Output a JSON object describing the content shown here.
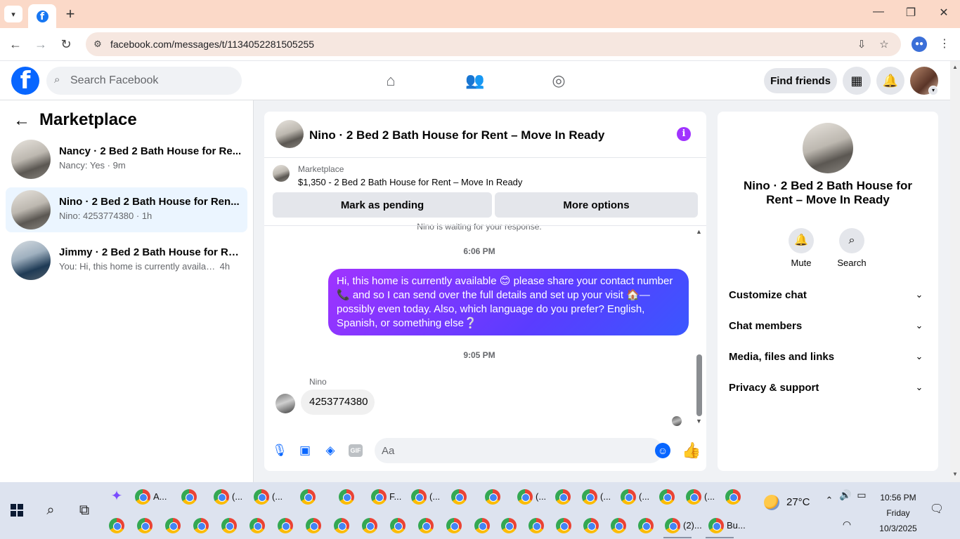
{
  "browser": {
    "url": "facebook.com/messages/t/1134052281505255"
  },
  "header": {
    "search_placeholder": "Search Facebook",
    "find_friends_label": "Find friends"
  },
  "sidebar": {
    "title": "Marketplace",
    "conversations": [
      {
        "name": "Nancy · 2 Bed 2 Bath House for Re...",
        "snippet": "Nancy: Yes",
        "time": "9m",
        "active": false
      },
      {
        "name": "Nino · 2 Bed 2 Bath House for Ren...",
        "snippet": "Nino: 4253774380",
        "time": "1h",
        "active": true
      },
      {
        "name": "Jimmy · 2 Bed 2 Bath House for Re...",
        "snippet": "You: Hi, this home is currently availabl...",
        "time": "4h",
        "active": false
      }
    ]
  },
  "chat": {
    "title": "Nino · 2 Bed 2 Bath House for Rent – Move In Ready",
    "marketplace_label": "Marketplace",
    "listing": "$1,350 - 2 Bed 2 Bath House for Rent – Move In Ready",
    "mark_pending_label": "Mark as pending",
    "more_options_label": "More options",
    "waiting_text": "Nino is waiting for your response.",
    "time_1": "6:06 PM",
    "outgoing_message": "Hi, this home is currently available 😊 please share your contact number 📞 and  so I can send over the full details and set up your visit 🏠—possibly even today. Also, which language do you prefer? English, Spanish, or something else❔",
    "time_2": "9:05 PM",
    "sender_name": "Nino",
    "incoming_message": "4253774380",
    "input_placeholder": "Aa",
    "gif_label": "GIF"
  },
  "right_panel": {
    "name": "Nino · 2 Bed 2 Bath House for Rent – Move In Ready",
    "mute_label": "Mute",
    "search_label": "Search",
    "rows": [
      "Customize chat",
      "Chat members",
      "Media, files and links",
      "Privacy & support"
    ]
  },
  "taskbar": {
    "labels": [
      "A...",
      "(...",
      "(...",
      "F...",
      "(...",
      "(...",
      "(...",
      "(...",
      "(...",
      "(2)...",
      "Bu..."
    ],
    "temperature": "27°C",
    "time": "10:56 PM",
    "day": "Friday",
    "date": "10/3/2025"
  },
  "colors": {
    "facebook_blue": "#0866ff",
    "bubble_gradient_start": "#a033ff",
    "bubble_gradient_end": "#3a57ff",
    "active_conversation_bg": "#ebf5ff"
  },
  "icons": [
    "chevron-down-icon",
    "facebook-icon",
    "plus-icon",
    "minimize-icon",
    "restore-icon",
    "close-icon",
    "back-icon",
    "forward-icon",
    "reload-icon",
    "site-settings-icon",
    "install-icon",
    "star-icon",
    "profile-icon",
    "more-vert-icon",
    "search-icon",
    "home-icon",
    "friends-icon",
    "groups-icon",
    "menu-grid-icon",
    "bell-icon",
    "info-icon",
    "mic-icon",
    "photo-icon",
    "sticker-icon",
    "gif-icon",
    "emoji-icon",
    "like-icon",
    "arrow-left-icon"
  ]
}
